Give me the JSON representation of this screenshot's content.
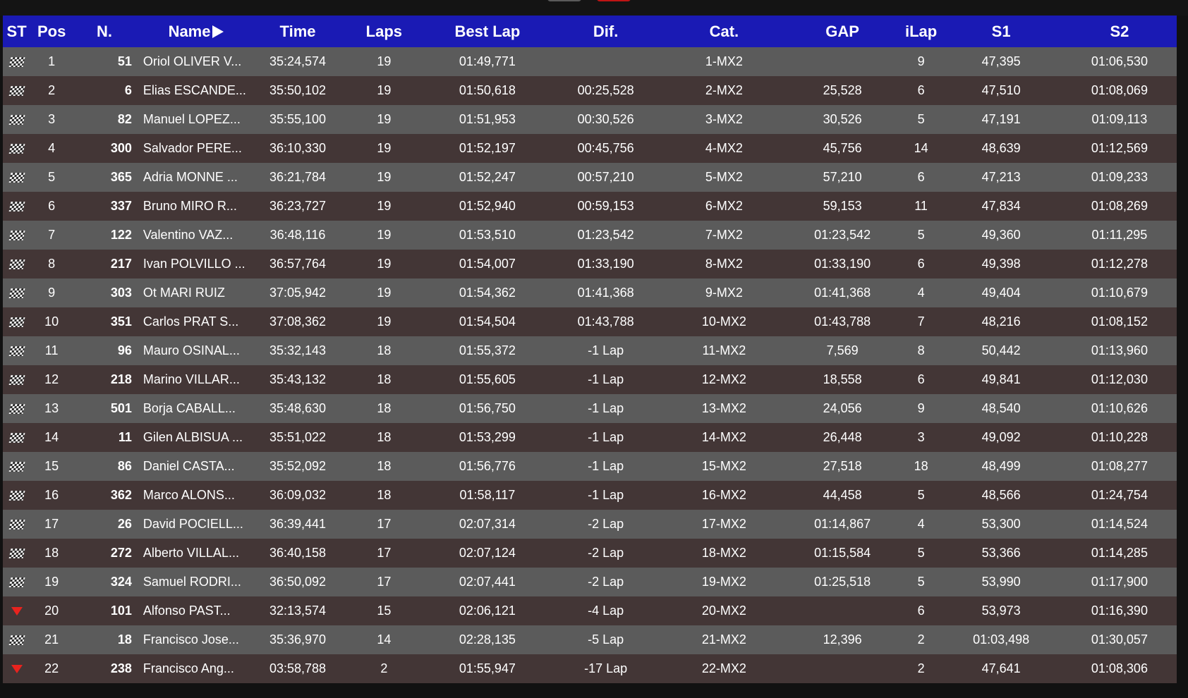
{
  "headers": {
    "st": "ST",
    "pos": "Pos",
    "num": "N.",
    "name": "Name",
    "time": "Time",
    "laps": "Laps",
    "best": "Best Lap",
    "dif": "Dif.",
    "cat": "Cat.",
    "gap": "GAP",
    "ilap": "iLap",
    "s1": "S1",
    "s2": "S2"
  },
  "icons": {
    "sort": "play-arrow-icon",
    "finished": "checkered-flag-icon",
    "dnf": "red-triangle-down-icon"
  },
  "colors": {
    "header_bg": "#1a1ab4",
    "row_light": "#5b5b5b",
    "row_dark": "#433636",
    "dnf_red": "#e8231e"
  },
  "rows": [
    {
      "st": "flag",
      "pos": "1",
      "num": "51",
      "name": "Oriol OLIVER V...",
      "time": "35:24,574",
      "laps": "19",
      "best": "01:49,771",
      "dif": "",
      "cat": "1-MX2",
      "gap": "",
      "ilap": "9",
      "s1": "47,395",
      "s2": "01:06,530"
    },
    {
      "st": "flag",
      "pos": "2",
      "num": "6",
      "name": "Elias ESCANDE...",
      "time": "35:50,102",
      "laps": "19",
      "best": "01:50,618",
      "dif": "00:25,528",
      "cat": "2-MX2",
      "gap": "25,528",
      "ilap": "6",
      "s1": "47,510",
      "s2": "01:08,069"
    },
    {
      "st": "flag",
      "pos": "3",
      "num": "82",
      "name": "Manuel LOPEZ...",
      "time": "35:55,100",
      "laps": "19",
      "best": "01:51,953",
      "dif": "00:30,526",
      "cat": "3-MX2",
      "gap": "30,526",
      "ilap": "5",
      "s1": "47,191",
      "s2": "01:09,113"
    },
    {
      "st": "flag",
      "pos": "4",
      "num": "300",
      "name": "Salvador PERE...",
      "time": "36:10,330",
      "laps": "19",
      "best": "01:52,197",
      "dif": "00:45,756",
      "cat": "4-MX2",
      "gap": "45,756",
      "ilap": "14",
      "s1": "48,639",
      "s2": "01:12,569"
    },
    {
      "st": "flag",
      "pos": "5",
      "num": "365",
      "name": "Adria MONNE ...",
      "time": "36:21,784",
      "laps": "19",
      "best": "01:52,247",
      "dif": "00:57,210",
      "cat": "5-MX2",
      "gap": "57,210",
      "ilap": "6",
      "s1": "47,213",
      "s2": "01:09,233"
    },
    {
      "st": "flag",
      "pos": "6",
      "num": "337",
      "name": "Bruno MIRO R...",
      "time": "36:23,727",
      "laps": "19",
      "best": "01:52,940",
      "dif": "00:59,153",
      "cat": "6-MX2",
      "gap": "59,153",
      "ilap": "11",
      "s1": "47,834",
      "s2": "01:08,269"
    },
    {
      "st": "flag",
      "pos": "7",
      "num": "122",
      "name": "Valentino VAZ...",
      "time": "36:48,116",
      "laps": "19",
      "best": "01:53,510",
      "dif": "01:23,542",
      "cat": "7-MX2",
      "gap": "01:23,542",
      "ilap": "5",
      "s1": "49,360",
      "s2": "01:11,295"
    },
    {
      "st": "flag",
      "pos": "8",
      "num": "217",
      "name": "Ivan POLVILLO ...",
      "time": "36:57,764",
      "laps": "19",
      "best": "01:54,007",
      "dif": "01:33,190",
      "cat": "8-MX2",
      "gap": "01:33,190",
      "ilap": "6",
      "s1": "49,398",
      "s2": "01:12,278"
    },
    {
      "st": "flag",
      "pos": "9",
      "num": "303",
      "name": "Ot MARI RUIZ",
      "time": "37:05,942",
      "laps": "19",
      "best": "01:54,362",
      "dif": "01:41,368",
      "cat": "9-MX2",
      "gap": "01:41,368",
      "ilap": "4",
      "s1": "49,404",
      "s2": "01:10,679"
    },
    {
      "st": "flag",
      "pos": "10",
      "num": "351",
      "name": "Carlos PRAT S...",
      "time": "37:08,362",
      "laps": "19",
      "best": "01:54,504",
      "dif": "01:43,788",
      "cat": "10-MX2",
      "gap": "01:43,788",
      "ilap": "7",
      "s1": "48,216",
      "s2": "01:08,152"
    },
    {
      "st": "flag",
      "pos": "11",
      "num": "96",
      "name": "Mauro OSINAL...",
      "time": "35:32,143",
      "laps": "18",
      "best": "01:55,372",
      "dif": "-1 Lap",
      "cat": "11-MX2",
      "gap": "7,569",
      "ilap": "8",
      "s1": "50,442",
      "s2": "01:13,960"
    },
    {
      "st": "flag",
      "pos": "12",
      "num": "218",
      "name": "Marino VILLAR...",
      "time": "35:43,132",
      "laps": "18",
      "best": "01:55,605",
      "dif": "-1 Lap",
      "cat": "12-MX2",
      "gap": "18,558",
      "ilap": "6",
      "s1": "49,841",
      "s2": "01:12,030"
    },
    {
      "st": "flag",
      "pos": "13",
      "num": "501",
      "name": "Borja CABALL...",
      "time": "35:48,630",
      "laps": "18",
      "best": "01:56,750",
      "dif": "-1 Lap",
      "cat": "13-MX2",
      "gap": "24,056",
      "ilap": "9",
      "s1": "48,540",
      "s2": "01:10,626"
    },
    {
      "st": "flag",
      "pos": "14",
      "num": "11",
      "name": "Gilen ALBISUA ...",
      "time": "35:51,022",
      "laps": "18",
      "best": "01:53,299",
      "dif": "-1 Lap",
      "cat": "14-MX2",
      "gap": "26,448",
      "ilap": "3",
      "s1": "49,092",
      "s2": "01:10,228"
    },
    {
      "st": "flag",
      "pos": "15",
      "num": "86",
      "name": "Daniel CASTA...",
      "time": "35:52,092",
      "laps": "18",
      "best": "01:56,776",
      "dif": "-1 Lap",
      "cat": "15-MX2",
      "gap": "27,518",
      "ilap": "18",
      "s1": "48,499",
      "s2": "01:08,277"
    },
    {
      "st": "flag",
      "pos": "16",
      "num": "362",
      "name": "Marco ALONS...",
      "time": "36:09,032",
      "laps": "18",
      "best": "01:58,117",
      "dif": "-1 Lap",
      "cat": "16-MX2",
      "gap": "44,458",
      "ilap": "5",
      "s1": "48,566",
      "s2": "01:24,754"
    },
    {
      "st": "flag",
      "pos": "17",
      "num": "26",
      "name": "David POCIELL...",
      "time": "36:39,441",
      "laps": "17",
      "best": "02:07,314",
      "dif": "-2 Lap",
      "cat": "17-MX2",
      "gap": "01:14,867",
      "ilap": "4",
      "s1": "53,300",
      "s2": "01:14,524"
    },
    {
      "st": "flag",
      "pos": "18",
      "num": "272",
      "name": "Alberto VILLAL...",
      "time": "36:40,158",
      "laps": "17",
      "best": "02:07,124",
      "dif": "-2 Lap",
      "cat": "18-MX2",
      "gap": "01:15,584",
      "ilap": "5",
      "s1": "53,366",
      "s2": "01:14,285"
    },
    {
      "st": "flag",
      "pos": "19",
      "num": "324",
      "name": "Samuel RODRI...",
      "time": "36:50,092",
      "laps": "17",
      "best": "02:07,441",
      "dif": "-2 Lap",
      "cat": "19-MX2",
      "gap": "01:25,518",
      "ilap": "5",
      "s1": "53,990",
      "s2": "01:17,900"
    },
    {
      "st": "dnf",
      "pos": "20",
      "num": "101",
      "name": "Alfonso PAST...",
      "time": "32:13,574",
      "laps": "15",
      "best": "02:06,121",
      "dif": "-4 Lap",
      "cat": "20-MX2",
      "gap": "",
      "ilap": "6",
      "s1": "53,973",
      "s2": "01:16,390"
    },
    {
      "st": "flag",
      "pos": "21",
      "num": "18",
      "name": "Francisco Jose...",
      "time": "35:36,970",
      "laps": "14",
      "best": "02:28,135",
      "dif": "-5 Lap",
      "cat": "21-MX2",
      "gap": "12,396",
      "ilap": "2",
      "s1": "01:03,498",
      "s2": "01:30,057"
    },
    {
      "st": "dnf",
      "pos": "22",
      "num": "238",
      "name": "Francisco Ang...",
      "time": "03:58,788",
      "laps": "2",
      "best": "01:55,947",
      "dif": "-17 Lap",
      "cat": "22-MX2",
      "gap": "",
      "ilap": "2",
      "s1": "47,641",
      "s2": "01:08,306"
    }
  ]
}
